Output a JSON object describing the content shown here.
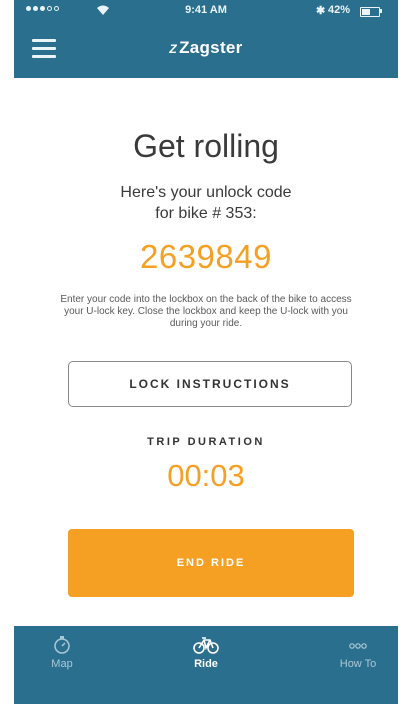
{
  "status_bar": {
    "time": "9:41 AM",
    "battery_percent": "42%",
    "bluetooth": "✱"
  },
  "header": {
    "brand_mark": "Z",
    "brand_name": "Zagster"
  },
  "main": {
    "title": "Get rolling",
    "subtitle_line1": "Here's your unlock code",
    "subtitle_line2": "for bike # 353:",
    "unlock_code": "2639849",
    "instructions": "Enter your code into the lockbox on the back of the bike to access your U-lock key. Close the lockbox and keep the U-lock with you during your ride.",
    "lock_instructions_label": "LOCK INSTRUCTIONS",
    "trip_duration_label": "TRIP DURATION",
    "trip_duration_value": "00:03",
    "end_ride_label": "END RIDE"
  },
  "tabs": [
    {
      "label": "Map",
      "icon": "compass-icon",
      "active": false
    },
    {
      "label": "Ride",
      "icon": "bike-icon",
      "active": true
    },
    {
      "label": "How To",
      "icon": "more-dots-icon",
      "active": false
    }
  ],
  "colors": {
    "primary": "#2b6f8f",
    "accent": "#f5a023"
  }
}
